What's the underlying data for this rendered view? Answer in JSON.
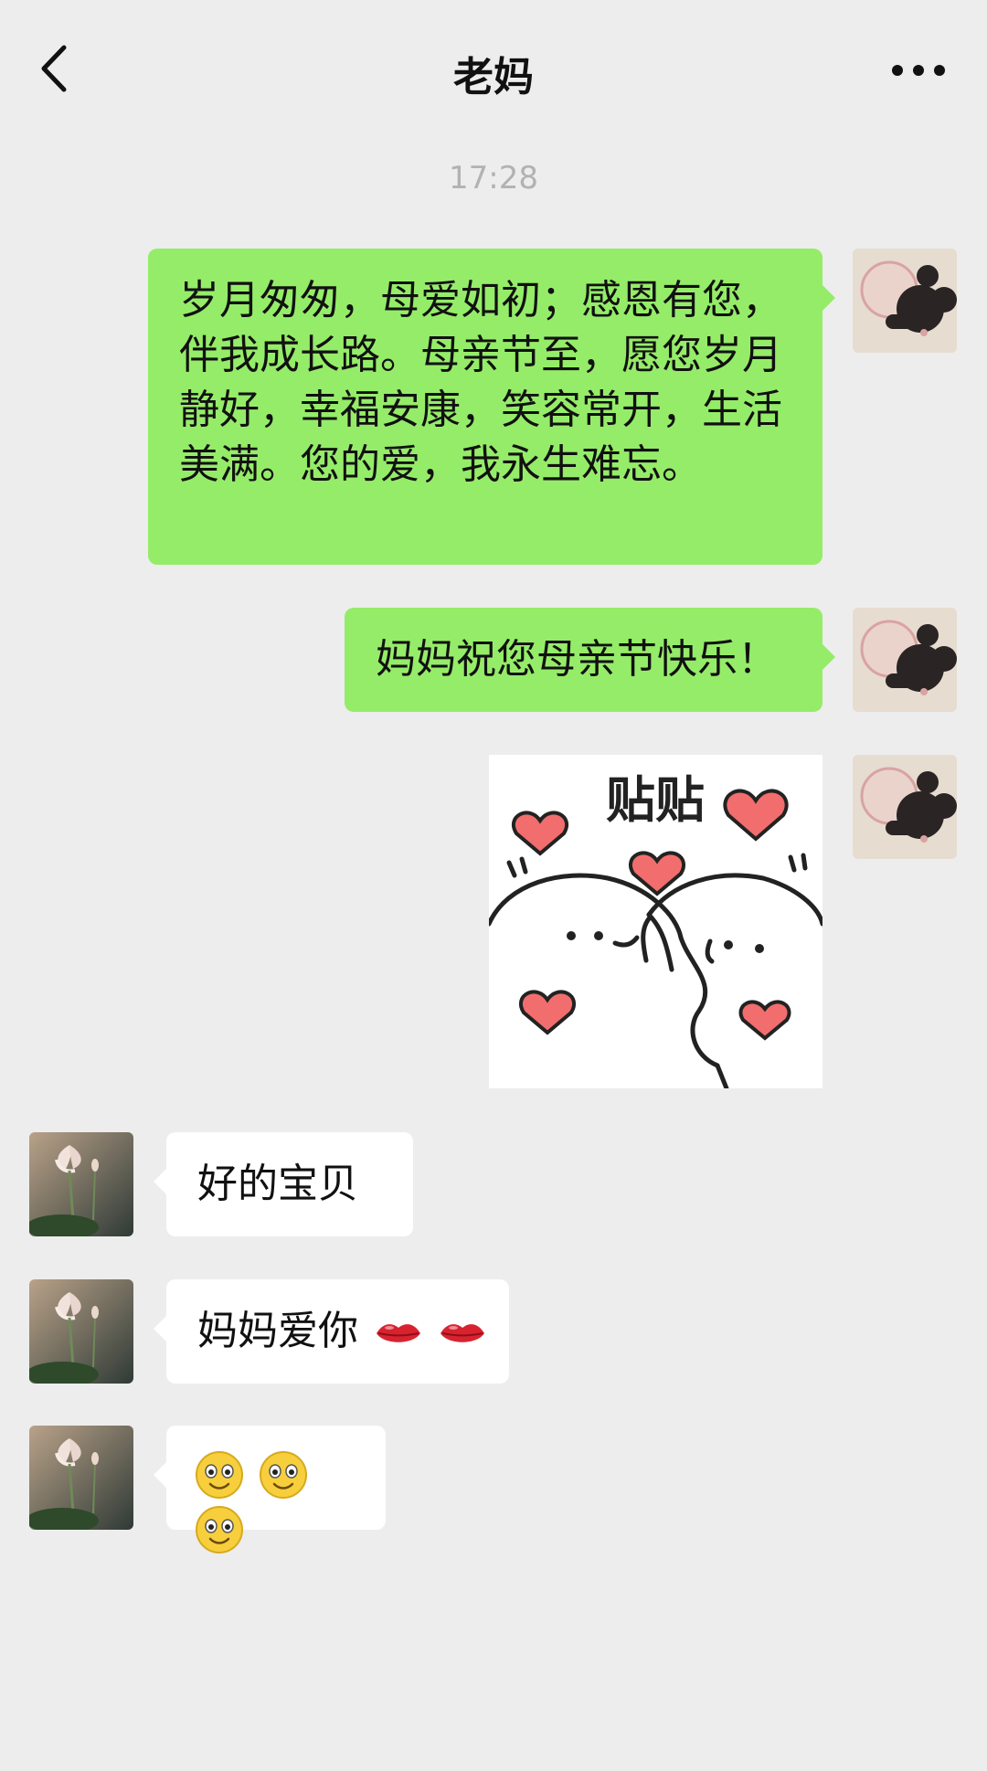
{
  "header": {
    "title": "老妈",
    "back_icon": "chevron-left-icon",
    "more_icon": "more-dots-icon"
  },
  "timestamp": "17:28",
  "messages": [
    {
      "side": "right",
      "type": "text",
      "text": "岁月匆匆，母爱如初；感恩有您，伴我成长路。母亲节至，愿您岁月静好，幸福安康，笑容常开，生活美满。您的爱，我永生难忘。"
    },
    {
      "side": "right",
      "type": "text",
      "text": "妈妈祝您母亲节快乐！"
    },
    {
      "side": "right",
      "type": "sticker",
      "text": "贴贴"
    },
    {
      "side": "left",
      "type": "text",
      "text": "好的宝贝"
    },
    {
      "side": "left",
      "type": "text",
      "text": "妈妈爱你",
      "emoji": "lips-emoji x2"
    },
    {
      "side": "left",
      "type": "emoji",
      "emoji": "smiley-emoji x3"
    }
  ],
  "colors": {
    "background": "#ededed",
    "sent_bubble": "#95ec69",
    "received_bubble": "#ffffff",
    "timestamp": "#b2b2b2",
    "heart": "#f26d6d"
  }
}
